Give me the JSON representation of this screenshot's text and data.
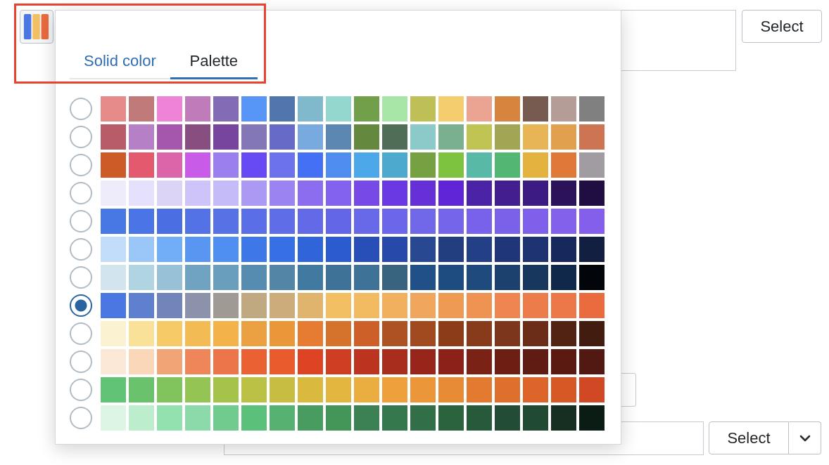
{
  "background_form": {
    "top_button": "Select",
    "bottom_button": "Select"
  },
  "tabs": [
    {
      "label": "Solid color",
      "selected": false
    },
    {
      "label": "Palette",
      "selected": true
    }
  ],
  "palettes": [
    {
      "selected": false,
      "swatches": [
        {
          "color": "#e68a8a"
        },
        {
          "color": "#c07a7a"
        },
        {
          "color": "#ef83d8"
        },
        {
          "color": "#c07bbb"
        },
        {
          "color": "#836bb5"
        },
        {
          "color": "#5795f7"
        },
        {
          "color": "#5175ad"
        },
        {
          "color": "#80b9cc"
        },
        {
          "color": "#93d7cf"
        },
        {
          "color": "#72a04a"
        },
        {
          "color": "#a7e6a6"
        },
        {
          "color": "#bec057"
        },
        {
          "color": "#f4cd6f"
        },
        {
          "color": "#eba491"
        },
        {
          "color": "#d7843e"
        },
        {
          "color": "#775b50"
        },
        {
          "color": "#b39d96"
        },
        {
          "color": "#808080"
        }
      ]
    },
    {
      "selected": false,
      "swatches": [
        {
          "color": "#b85c69"
        },
        {
          "color": "#b580c5"
        },
        {
          "color": "#a557ad"
        },
        {
          "color": "#884e7f"
        },
        {
          "color": "#77449e"
        },
        {
          "color": "#8477b7"
        },
        {
          "color": "#676bc7"
        },
        {
          "color": "#78aadf"
        },
        {
          "color": "#5c87b3"
        },
        {
          "color": "#64883e"
        },
        {
          "color": "#506e57"
        },
        {
          "color": "#8cc9c9"
        },
        {
          "color": "#7aaf90"
        },
        {
          "color": "#c0c453"
        },
        {
          "color": "#a2a553"
        },
        {
          "color": "#e8b556"
        },
        {
          "color": "#e0a04e"
        },
        {
          "color": "#cd7452"
        }
      ]
    },
    {
      "selected": false,
      "swatches": [
        {
          "color": "#cd5b27"
        },
        {
          "color": "#e35a6f"
        },
        {
          "color": "#dc65aa"
        },
        {
          "color": "#c85ce8"
        },
        {
          "color": "#9a80ef"
        },
        {
          "color": "#674af4"
        },
        {
          "color": "#6c72ec"
        },
        {
          "color": "#4370f4"
        },
        {
          "color": "#4f8ef0"
        },
        {
          "color": "#4ca8e9"
        },
        {
          "color": "#4daace"
        },
        {
          "color": "#76a143"
        },
        {
          "color": "#7ec340"
        },
        {
          "color": "#57b9a6"
        },
        {
          "color": "#53b673"
        },
        {
          "color": "#e4b33f"
        },
        {
          "color": "#e07838"
        },
        {
          "color": "#a09ca1"
        }
      ]
    },
    {
      "selected": false,
      "swatches": [
        {
          "color": "#eeebfb"
        },
        {
          "color": "#e5e1fc"
        },
        {
          "color": "#dcd4f7"
        },
        {
          "color": "#cec4fa"
        },
        {
          "color": "#c4bbf8"
        },
        {
          "color": "#ac99f3"
        },
        {
          "color": "#9b84f2"
        },
        {
          "color": "#8c6df0"
        },
        {
          "color": "#8262ee"
        },
        {
          "color": "#774ae7"
        },
        {
          "color": "#6b39e3"
        },
        {
          "color": "#6530d7"
        },
        {
          "color": "#5f25d7"
        },
        {
          "color": "#4a23a6"
        },
        {
          "color": "#421e8e"
        },
        {
          "color": "#3c1c82"
        },
        {
          "color": "#2c1359"
        },
        {
          "color": "#200e43"
        }
      ]
    },
    {
      "selected": false,
      "swatches": [
        {
          "color": "#4878e3"
        },
        {
          "color": "#4b74e6"
        },
        {
          "color": "#4c6ee3"
        },
        {
          "color": "#5372e5"
        },
        {
          "color": "#5672e5"
        },
        {
          "color": "#5a6fe7"
        },
        {
          "color": "#5f6de7"
        },
        {
          "color": "#626ae8"
        },
        {
          "color": "#6466e8"
        },
        {
          "color": "#6769e8"
        },
        {
          "color": "#6c66ea"
        },
        {
          "color": "#7067e9"
        },
        {
          "color": "#7465ea"
        },
        {
          "color": "#7862eb"
        },
        {
          "color": "#7b61e9"
        },
        {
          "color": "#7f60ea"
        },
        {
          "color": "#8361ea"
        },
        {
          "color": "#835feb"
        }
      ]
    },
    {
      "selected": false,
      "swatches": [
        {
          "color": "#c1ddfa"
        },
        {
          "color": "#9ac6f8"
        },
        {
          "color": "#71aef7"
        },
        {
          "color": "#5996f2"
        },
        {
          "color": "#4f8ff2"
        },
        {
          "color": "#3e78e8"
        },
        {
          "color": "#366fe6"
        },
        {
          "color": "#3064d9"
        },
        {
          "color": "#2c5bd0"
        },
        {
          "color": "#284fb8"
        },
        {
          "color": "#2749a9"
        },
        {
          "color": "#284892"
        },
        {
          "color": "#223e7f"
        },
        {
          "color": "#233f86"
        },
        {
          "color": "#1f3779"
        },
        {
          "color": "#1e3371"
        },
        {
          "color": "#17295c"
        },
        {
          "color": "#121f41"
        }
      ]
    },
    {
      "selected": false,
      "swatches": [
        {
          "color": "#d2e5ef"
        },
        {
          "color": "#b1d4e3"
        },
        {
          "color": "#98c0d6"
        },
        {
          "color": "#70a3c1"
        },
        {
          "color": "#699fbd"
        },
        {
          "color": "#558cb0"
        },
        {
          "color": "#5285a6"
        },
        {
          "color": "#417aa0"
        },
        {
          "color": "#3e7297"
        },
        {
          "color": "#3e7296"
        },
        {
          "color": "#38647f"
        },
        {
          "color": "#215088"
        },
        {
          "color": "#1f4c80"
        },
        {
          "color": "#1e4a7d"
        },
        {
          "color": "#1c416f"
        },
        {
          "color": "#18375f"
        },
        {
          "color": "#10284a"
        },
        {
          "color": "#02060a"
        }
      ]
    },
    {
      "selected": true,
      "swatches": [
        {
          "color": "#4a77e1"
        },
        {
          "color": "#5f80cf"
        },
        {
          "color": "#7285bb"
        },
        {
          "color": "#8d92ab"
        },
        {
          "color": "#a09a95"
        },
        {
          "color": "#c0a880"
        },
        {
          "color": "#ccac7a"
        },
        {
          "color": "#e0b46c"
        },
        {
          "color": "#f2c062"
        },
        {
          "color": "#f2bb61"
        },
        {
          "color": "#f1b05e"
        },
        {
          "color": "#f0a65d"
        },
        {
          "color": "#ef9a53"
        },
        {
          "color": "#ee9351"
        },
        {
          "color": "#ef8550"
        },
        {
          "color": "#ec7d4a"
        },
        {
          "color": "#ec7849"
        },
        {
          "color": "#e96b3e"
        }
      ]
    },
    {
      "selected": false,
      "swatches": [
        {
          "color": "#fbf2d2"
        },
        {
          "color": "#f9e297"
        },
        {
          "color": "#f6ca67"
        },
        {
          "color": "#f2bb54"
        },
        {
          "color": "#f3b34a"
        },
        {
          "color": "#eba142"
        },
        {
          "color": "#ea973a"
        },
        {
          "color": "#e67c31"
        },
        {
          "color": "#d5732c"
        },
        {
          "color": "#cd5f29"
        },
        {
          "color": "#ad5222"
        },
        {
          "color": "#a14a20"
        },
        {
          "color": "#8c3d18"
        },
        {
          "color": "#873b1b"
        },
        {
          "color": "#7b361c"
        },
        {
          "color": "#6b2c18"
        },
        {
          "color": "#522212"
        },
        {
          "color": "#431c10"
        }
      ]
    },
    {
      "selected": false,
      "swatches": [
        {
          "color": "#fce8d6"
        },
        {
          "color": "#f9d7b8"
        },
        {
          "color": "#f1a577"
        },
        {
          "color": "#ef8659"
        },
        {
          "color": "#ec7649"
        },
        {
          "color": "#ea6133"
        },
        {
          "color": "#e95a2c"
        },
        {
          "color": "#de4324"
        },
        {
          "color": "#cf3e23"
        },
        {
          "color": "#bc331f"
        },
        {
          "color": "#a92d1c"
        },
        {
          "color": "#972519"
        },
        {
          "color": "#8c2217"
        },
        {
          "color": "#7b2216"
        },
        {
          "color": "#6d1f14"
        },
        {
          "color": "#601c12"
        },
        {
          "color": "#5a1a11"
        },
        {
          "color": "#511911"
        }
      ]
    },
    {
      "selected": false,
      "swatches": [
        {
          "color": "#60c376"
        },
        {
          "color": "#6ac26c"
        },
        {
          "color": "#81c35c"
        },
        {
          "color": "#93c454"
        },
        {
          "color": "#a5c24b"
        },
        {
          "color": "#bbc145"
        },
        {
          "color": "#c6bd42"
        },
        {
          "color": "#dab93f"
        },
        {
          "color": "#e3b73f"
        },
        {
          "color": "#e9ad40"
        },
        {
          "color": "#eda03c"
        },
        {
          "color": "#ec963a"
        },
        {
          "color": "#e88b35"
        },
        {
          "color": "#e27b30"
        },
        {
          "color": "#df6f2d"
        },
        {
          "color": "#dd6529"
        },
        {
          "color": "#d55825"
        },
        {
          "color": "#d14824"
        }
      ]
    },
    {
      "selected": false,
      "swatches": [
        {
          "color": "#ddf6e3"
        },
        {
          "color": "#bcedcc"
        },
        {
          "color": "#92e1ae"
        },
        {
          "color": "#8cd9aa"
        },
        {
          "color": "#6fcb8e"
        },
        {
          "color": "#5bc17a"
        },
        {
          "color": "#55b270"
        },
        {
          "color": "#489c60"
        },
        {
          "color": "#449558"
        },
        {
          "color": "#3b8154"
        },
        {
          "color": "#35784e"
        },
        {
          "color": "#326f49"
        },
        {
          "color": "#2b633f"
        },
        {
          "color": "#275a3b"
        },
        {
          "color": "#224d34"
        },
        {
          "color": "#214a33"
        },
        {
          "color": "#162f22"
        },
        {
          "color": "#0b1c14"
        }
      ]
    }
  ]
}
